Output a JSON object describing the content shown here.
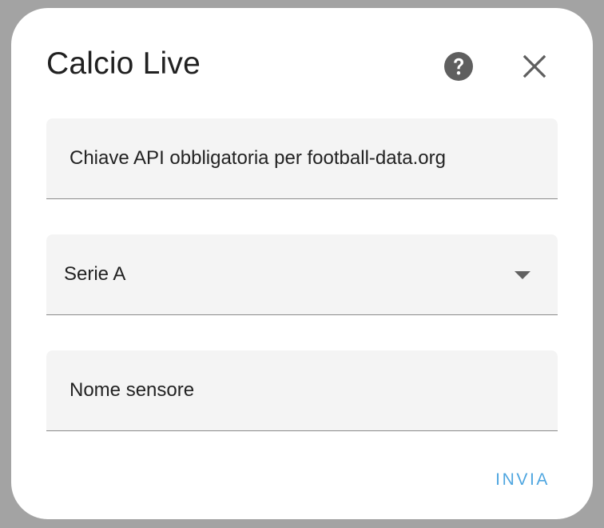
{
  "dialog": {
    "title": "Calcio Live",
    "help_icon": "help-circle-icon",
    "close_icon": "close-icon"
  },
  "form": {
    "api_key": {
      "placeholder": "Chiave API obbligatoria per football-data.org",
      "value": ""
    },
    "competition": {
      "selected": "Serie A"
    },
    "sensor_name": {
      "placeholder": "Nome sensore",
      "value": ""
    }
  },
  "actions": {
    "submit_label": "INVIA"
  },
  "colors": {
    "accent": "#4fa6e0",
    "field_bg": "#f4f4f4",
    "backdrop": "#a3a3a3"
  }
}
